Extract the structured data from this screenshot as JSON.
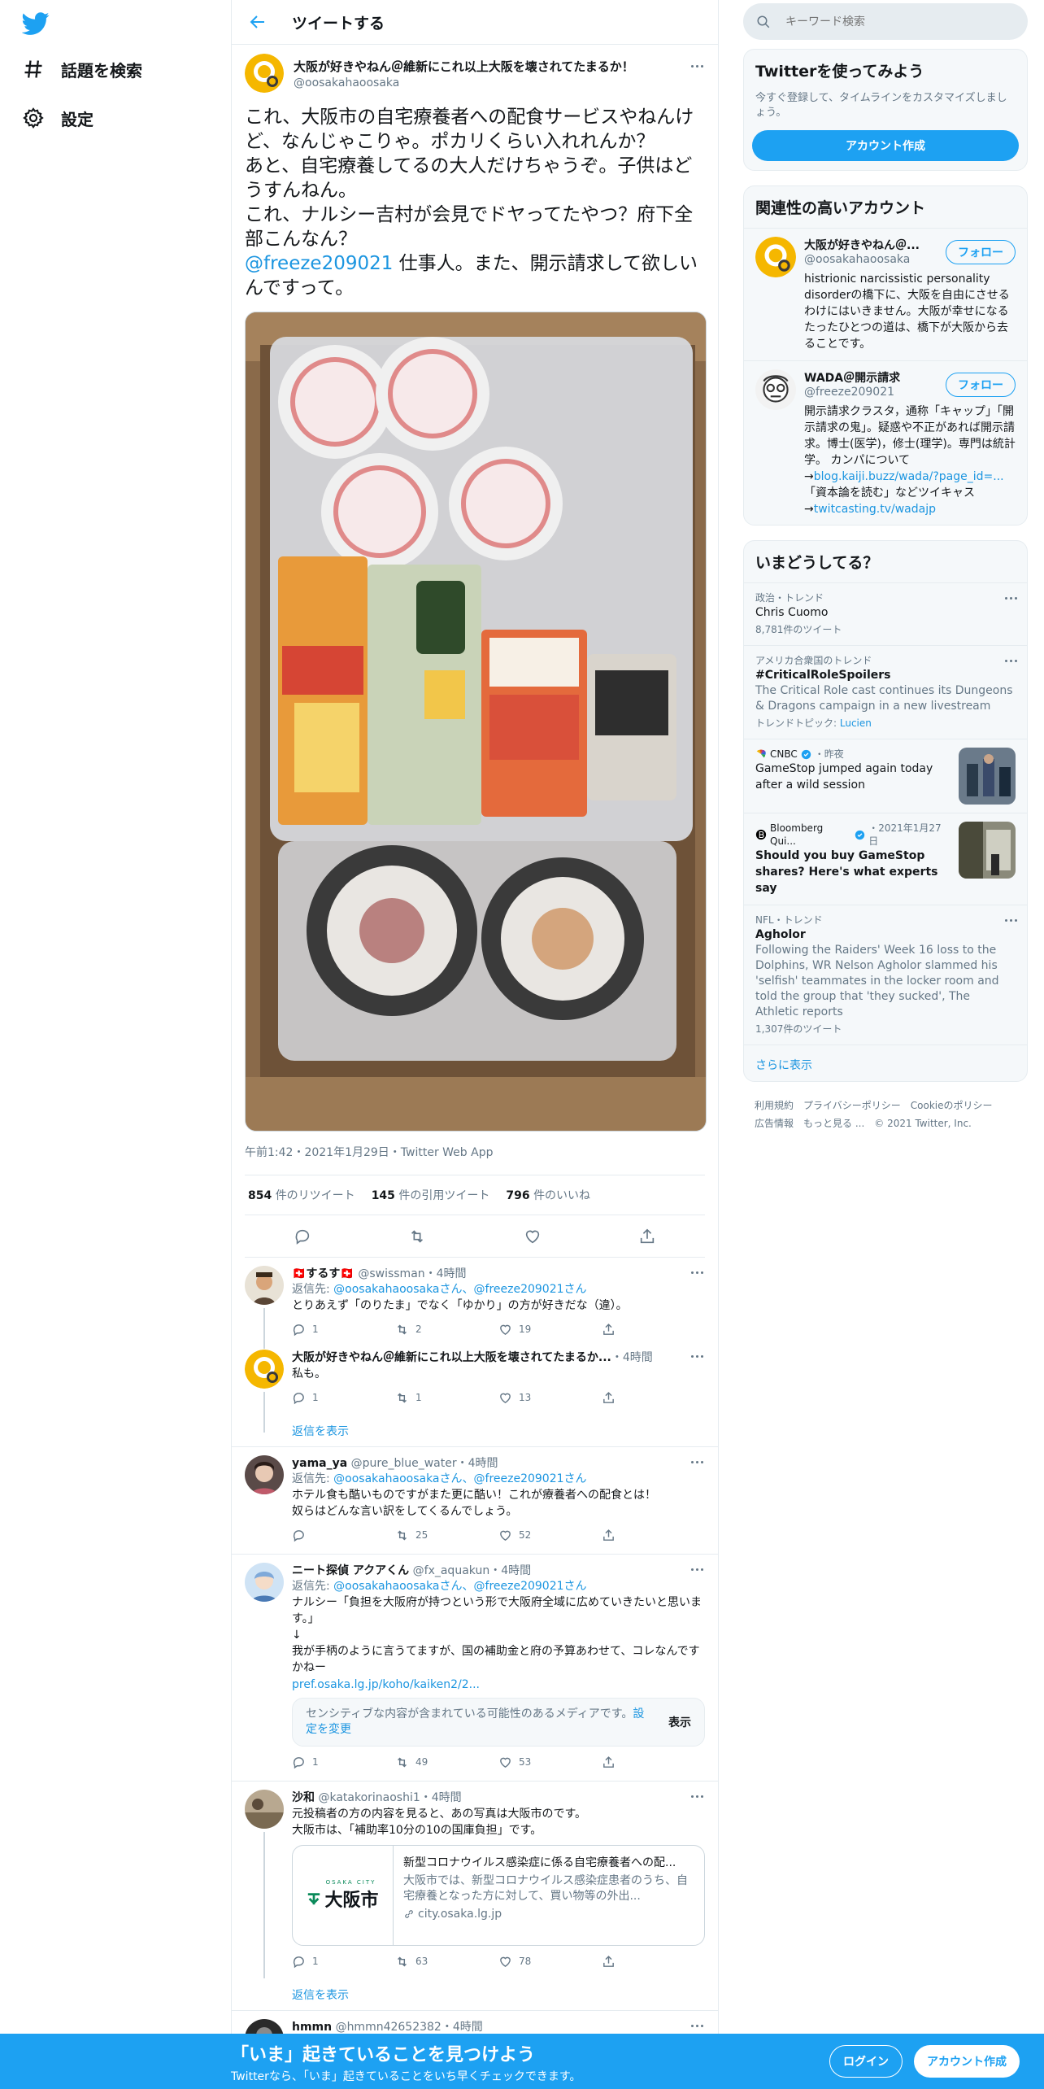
{
  "nav": {
    "explore_label": "話題を検索",
    "settings_label": "設定"
  },
  "header": {
    "title": "ツイートする"
  },
  "tweet": {
    "name": "大阪が好きやねん＠維新にこれ以上大阪を壊されてたまるか！",
    "handle": "@oosakahaoosaka",
    "text_part1": "これ、大阪市の自宅療養者への配食サービスやねんけど、なんじゃこりゃ。ポカリくらい入れれんか？\nあと、自宅療養してるの大人だけちゃうぞ。子供はどうすんねん。\nこれ、ナルシー吉村が会見でドヤってたやつ？府下全部こんなん？\n",
    "mention": "@freeze209021",
    "text_part2": " 仕事人。また、開示請求して欲しいんですって。",
    "meta": "午前1:42・2021年1月29日・Twitter Web App",
    "retweets": "854",
    "retweets_label": "件のリツイート",
    "quotes": "145",
    "quotes_label": "件の引用ツイート",
    "likes": "796",
    "likes_label": "件のいいね"
  },
  "replies": [
    {
      "name": "🇨🇭するす🇨🇭",
      "handle": "@swissman",
      "time": "・4時間",
      "reply_prefix": "返信先: ",
      "reply_to": "@oosakahaoosakaさん、@freeze209021さん",
      "text": "とりあえず「のりたま」でなく「ゆかり」の方が好きだな（違）。",
      "replies": "1",
      "retweets": "2",
      "likes": "19"
    },
    {
      "name": "大阪が好きやねん＠維新にこれ以上大阪を壊されてたまるか...",
      "handle": "",
      "time": "・4時間",
      "text": "私も。",
      "replies": "1",
      "retweets": "1",
      "likes": "13",
      "show_replies": "返信を表示"
    },
    {
      "name": "yama_ya",
      "handle": "@pure_blue_water",
      "time": "・4時間",
      "reply_prefix": "返信先: ",
      "reply_to": "@oosakahaoosakaさん、@freeze209021さん",
      "text": "ホテル食も酷いものですがまた更に酷い！これが療養者への配食とは！\n奴らはどんな言い訳をしてくるんでしょう。",
      "replies": "",
      "retweets": "25",
      "likes": "52"
    },
    {
      "name": "ニート探偵 アクアくん",
      "handle": "@fx_aquakun",
      "time": "・4時間",
      "reply_prefix": "返信先: ",
      "reply_to": "@oosakahaoosakaさん、@freeze209021さん",
      "text": "ナルシー「負担を大阪府が持つという形で大阪府全域に広めていきたいと思います。」\n↓\n我が手柄のように言うてますが、国の補助金と府の予算あわせて、コレなんですかねー",
      "link": "pref.osaka.lg.jp/koho/kaiken2/2...",
      "sensitive_text": "センシティブな内容が含まれている可能性のあるメディアです。",
      "sensitive_link": "設定を変更",
      "sensitive_show": "表示",
      "replies": "1",
      "retweets": "49",
      "likes": "53"
    },
    {
      "name": "沙和",
      "handle": "@katakorinaoshi1",
      "time": "・4時間",
      "text": "元投稿者の方の内容を見ると、あの写真は大阪市のです。\n大阪市は、「補助率10分の10の国庫負担」です。",
      "card_logo_small": "OSAKA CITY",
      "card_logo": "大阪市",
      "card_title": "新型コロナウイルス感染症に係る自宅療養者への配...",
      "card_desc": "大阪市では、新型コロナウイルス感染症患者のうち、自宅療養となった方に対して、買い物等の外出...",
      "card_url": "city.osaka.lg.jp",
      "replies": "1",
      "retweets": "63",
      "likes": "78",
      "show_replies": "返信を表示"
    },
    {
      "name": "hmmn",
      "handle": "@hmmn42652382",
      "time": "・4時間"
    }
  ],
  "right": {
    "search_placeholder": "キーワード検索",
    "signup_title": "Twitterを使ってみよう",
    "signup_sub": "今すぐ登録して、タイムラインをカスタマイズしましょう。",
    "signup_button": "アカウント作成",
    "related_title": "関連性の高いアカウント",
    "accounts": [
      {
        "name": "大阪が好きやねん＠...",
        "handle": "@oosakahaoosaka",
        "follow": "フォロー",
        "bio": "histrionic narcissistic personality disorderの橋下に、大阪を自由にさせるわけにはいきません。大阪が幸せになるたったひとつの道は、橋下が大阪から去ることです。"
      },
      {
        "name": "WADA＠開示請求",
        "handle": "@freeze209021",
        "follow": "フォロー",
        "bio": "開示請求クラスタ，通称「キャップ」「開示請求の鬼」。疑惑や不正があれば開示請求。博士(医学)，修士(理学)。専門は統計学。 カンパについて→",
        "link1": "blog.kaiji.buzz/wada/?page_id=...",
        "bio2": "「資本論を読む」などツイキャス→",
        "link2": "twitcasting.tv/wadajp"
      }
    ],
    "trends_title": "いまどうしてる？",
    "trends": [
      {
        "context": "政治・トレンド",
        "name": "Chris Cuomo",
        "count": "8,781件のツイート"
      },
      {
        "context": "アメリカ合衆国のトレンド",
        "name": "#CriticalRoleSpoilers",
        "desc": "The Critical Role cast continues its Dungeons & Dragons campaign in a new livestream",
        "topic_prefix": "トレンドトピック: ",
        "topic": "Lucien"
      },
      {
        "context": "CNBC",
        "time": "・昨夜",
        "name": "GameStop jumped again today after a wild session"
      },
      {
        "context": "Bloomberg Qui...",
        "time": "・2021年1月27日",
        "name": "Should you buy GameStop shares? Here's what experts say"
      },
      {
        "context": "NFL・トレンド",
        "name": "Agholor",
        "desc": "Following the Raiders' Week 16 loss to the Dolphins, WR Nelson Agholor slammed his 'selfish' teammates in the locker room and told the group that 'they sucked', The Athletic reports",
        "count": "1,307件のツイート"
      }
    ],
    "show_more": "さらに表示",
    "footer": [
      "利用規約",
      "プライバシーポリシー",
      "Cookieのポリシー",
      "広告情報",
      "もっと見る ...",
      "© 2021 Twitter, Inc."
    ]
  },
  "bottom": {
    "title": "「いま」起きていることを見つけよう",
    "sub": "Twitterなら、「いま」起きていることをいち早くチェックできます。",
    "login": "ログイン",
    "signup": "アカウント作成"
  },
  "colors": {
    "accent": "#1da1f2",
    "link": "#1b95e0",
    "text": "#14171a",
    "secondary": "#657786"
  }
}
